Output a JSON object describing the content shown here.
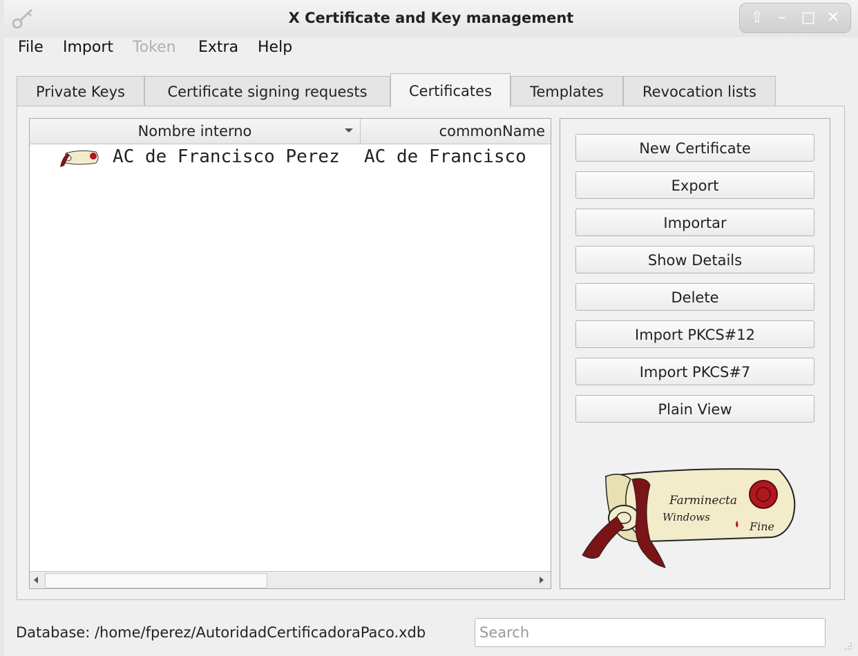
{
  "window": {
    "title": "X Certificate and Key management"
  },
  "menubar": [
    {
      "label": "File",
      "enabled": true
    },
    {
      "label": "Import",
      "enabled": true
    },
    {
      "label": "Token",
      "enabled": false
    },
    {
      "label": "Extra",
      "enabled": true
    },
    {
      "label": "Help",
      "enabled": true
    }
  ],
  "tabs": [
    {
      "label": "Private Keys",
      "active": false
    },
    {
      "label": "Certificate signing requests",
      "active": false
    },
    {
      "label": "Certificates",
      "active": true
    },
    {
      "label": "Templates",
      "active": false
    },
    {
      "label": "Revocation lists",
      "active": false
    }
  ],
  "list": {
    "columns": [
      "Nombre interno",
      "commonName"
    ],
    "sort_indicator_icon": "sort-down-icon",
    "rows": [
      {
        "icon": "certificate-icon",
        "cells": [
          "AC de Francisco Perez",
          "AC de Francisco"
        ]
      }
    ]
  },
  "buttons": [
    {
      "label": "New Certificate"
    },
    {
      "label": "Export"
    },
    {
      "label": "Importar"
    },
    {
      "label": "Show Details"
    },
    {
      "label": "Delete"
    },
    {
      "label": "Import PKCS#12"
    },
    {
      "label": "Import PKCS#7"
    },
    {
      "label": "Plain View"
    }
  ],
  "logo": {
    "icon": "certificate-scroll-logo",
    "lines": [
      "Farminecta",
      "Windows",
      "Fine"
    ]
  },
  "status": {
    "database_label": "Database: /home/fperez/AutoridadCertificadoraPaco.xdb",
    "search_placeholder": "Search",
    "search_value": ""
  },
  "colors": {
    "seal_red": "#b0181e",
    "ribbon": "#7a1416",
    "scroll": "#f3eccb"
  }
}
